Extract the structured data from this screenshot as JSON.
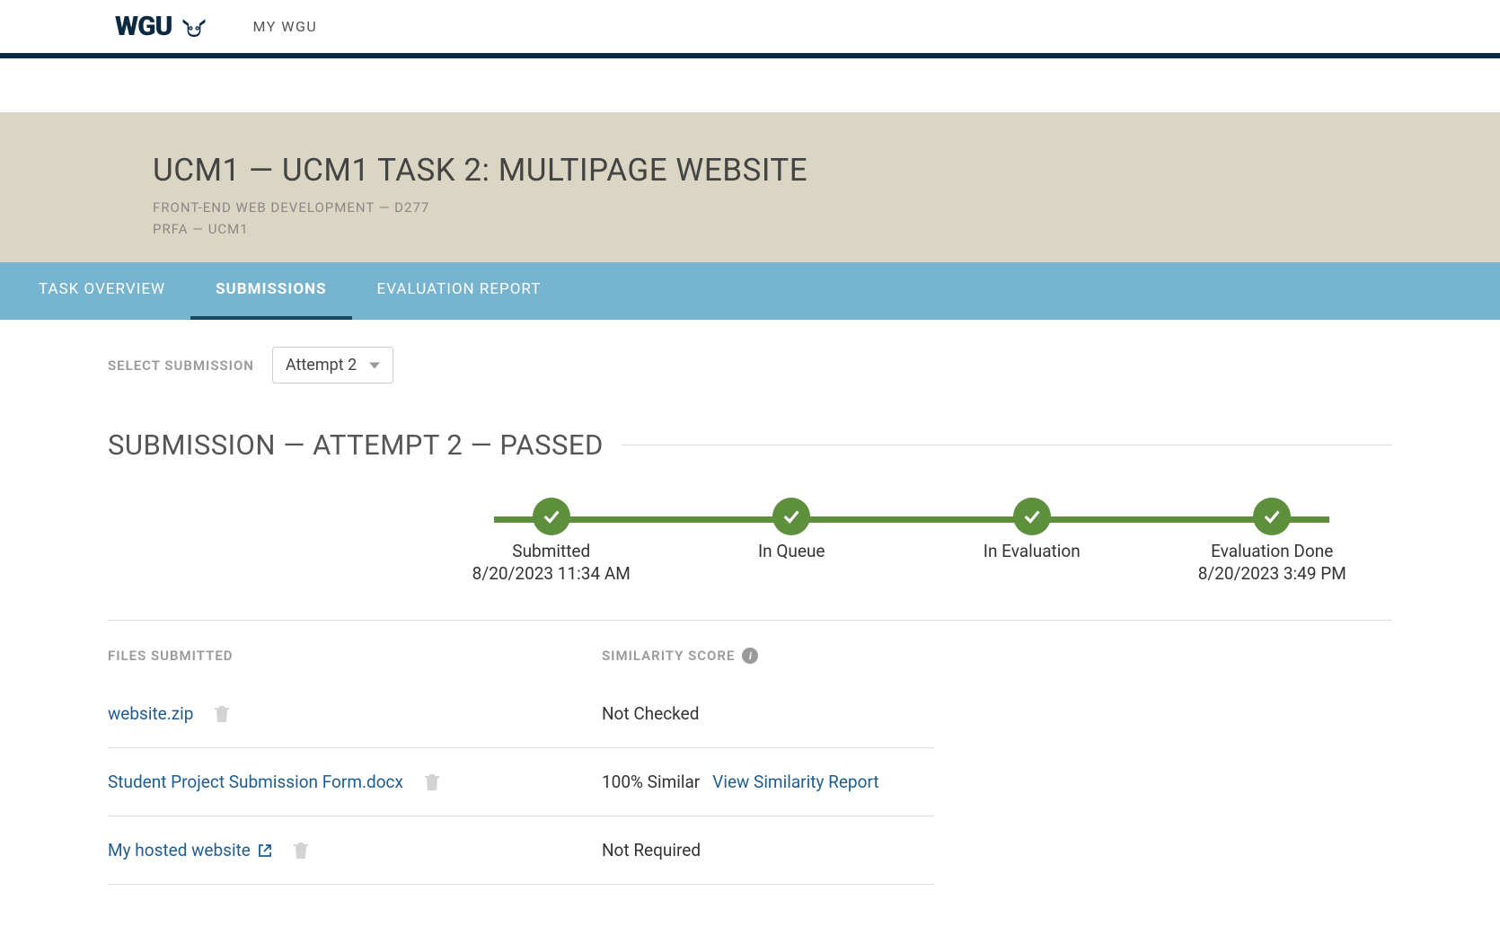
{
  "nav": {
    "logo_text": "WGU",
    "my_wgu": "MY WGU"
  },
  "header": {
    "title": "UCM1 — UCM1 TASK 2: MULTIPAGE WEBSITE",
    "subtitle1": "FRONT-END WEB DEVELOPMENT — D277",
    "subtitle2": "PRFA — UCM1"
  },
  "tabs": [
    {
      "label": "TASK OVERVIEW",
      "active": false
    },
    {
      "label": "SUBMISSIONS",
      "active": true
    },
    {
      "label": "EVALUATION REPORT",
      "active": false
    }
  ],
  "select": {
    "label": "SELECT SUBMISSION",
    "value": "Attempt 2"
  },
  "submission_heading": "SUBMISSION — ATTEMPT 2 — PASSED",
  "progress_steps": [
    {
      "label": "Submitted",
      "date": "8/20/2023 11:34 AM"
    },
    {
      "label": "In Queue",
      "date": ""
    },
    {
      "label": "In Evaluation",
      "date": ""
    },
    {
      "label": "Evaluation Done",
      "date": "8/20/2023 3:49 PM"
    }
  ],
  "files_section": {
    "files_header": "FILES SUBMITTED",
    "similarity_header": "SIMILARITY SCORE",
    "rows": [
      {
        "name": "website.zip",
        "external": false,
        "similarity": "Not Checked",
        "link": ""
      },
      {
        "name": "Student Project Submission Form.docx",
        "external": false,
        "similarity": "100% Similar",
        "link": "View Similarity Report"
      },
      {
        "name": "My hosted website",
        "external": true,
        "similarity": "Not Required",
        "link": ""
      }
    ]
  }
}
